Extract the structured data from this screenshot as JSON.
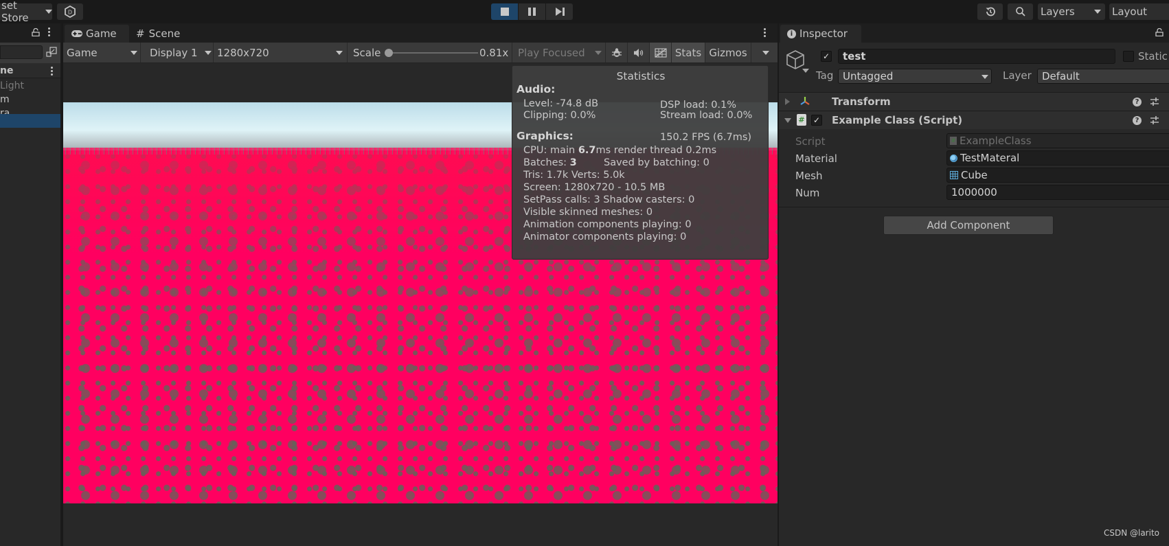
{
  "toolbar": {
    "asset_store_label": "set Store",
    "account_icon": "unity-account-icon",
    "play_controls": [
      {
        "name": "stop",
        "icon": "stop-icon",
        "active": true
      },
      {
        "name": "pause",
        "icon": "pause-icon",
        "active": false
      },
      {
        "name": "step",
        "icon": "step-icon",
        "active": false
      }
    ],
    "history_icon": "history-icon",
    "search_icon": "search-icon",
    "layers_label": "Layers",
    "layout_label": "Layout",
    "active_color": "#1e4569"
  },
  "hierarchy": {
    "scene_label": "ne",
    "items": [
      {
        "label": "Light",
        "dimmed": true,
        "selected": false
      },
      {
        "label": "m",
        "dimmed": false,
        "selected": false
      },
      {
        "label": "ra",
        "dimmed": false,
        "selected": false
      },
      {
        "label": "",
        "dimmed": false,
        "selected": true
      }
    ],
    "selected_color": "#1e4569"
  },
  "game_view": {
    "tabs": [
      {
        "label": "Game",
        "icon": "gamepad-icon",
        "active": true
      },
      {
        "label": "Scene",
        "icon": "grid-icon",
        "active": false
      }
    ],
    "controls": {
      "view_mode": "Game",
      "display": "Display 1",
      "resolution": "1280x720",
      "scale_label": "Scale",
      "scale_value": "0.81x",
      "scale_fraction": 0.0,
      "play_mode": "Play Focused",
      "stats_label": "Stats",
      "gizmos_label": "Gizmos"
    }
  },
  "stats": {
    "title": "Statistics",
    "audio_header": "Audio:",
    "level": "Level: -74.8 dB",
    "clipping": "Clipping: 0.0%",
    "dsp_load": "DSP load: 0.1%",
    "stream_load": "Stream load: 0.0%",
    "graphics_header": "Graphics:",
    "fps": "150.2 FPS (6.7ms)",
    "cpu_prefix": "CPU: main ",
    "cpu_main": "6.7",
    "cpu_suffix": "ms  render thread 0.2ms",
    "batches_prefix": "Batches: ",
    "batches": "3",
    "saved_by_batching": "Saved by batching: 0",
    "tris_verts": "Tris: 1.7k   Verts: 5.0k",
    "screen": "Screen: 1280x720 - 10.5 MB",
    "setpass": "SetPass calls: 3 Shadow casters: 0",
    "skinned": "Visible skinned meshes: 0",
    "animation": "Animation components playing: 0",
    "animator": "Animator components playing: 0"
  },
  "inspector": {
    "tab_label": "Inspector",
    "object_name": "test",
    "active": true,
    "static_label": "Static",
    "static_checked": false,
    "tag_label": "Tag",
    "tag_value": "Untagged",
    "layer_label": "Layer",
    "layer_value": "Default",
    "components": [
      {
        "name": "Transform",
        "expanded": false,
        "icon": "transform-icon"
      },
      {
        "name": "Example Class (Script)",
        "expanded": true,
        "enabled": true,
        "icon": "script-icon"
      }
    ],
    "fields": [
      {
        "label": "Script",
        "value": "ExampleClass",
        "icon": "script-icon",
        "disabled": true
      },
      {
        "label": "Material",
        "value": "TestMateral",
        "icon": "material-icon",
        "disabled": false
      },
      {
        "label": "Mesh",
        "value": "Cube",
        "icon": "mesh-icon",
        "disabled": false
      },
      {
        "label": "Num",
        "value": "1000000",
        "icon": "",
        "disabled": false
      }
    ],
    "add_component_label": "Add Component"
  },
  "watermark": "CSDN @larito"
}
